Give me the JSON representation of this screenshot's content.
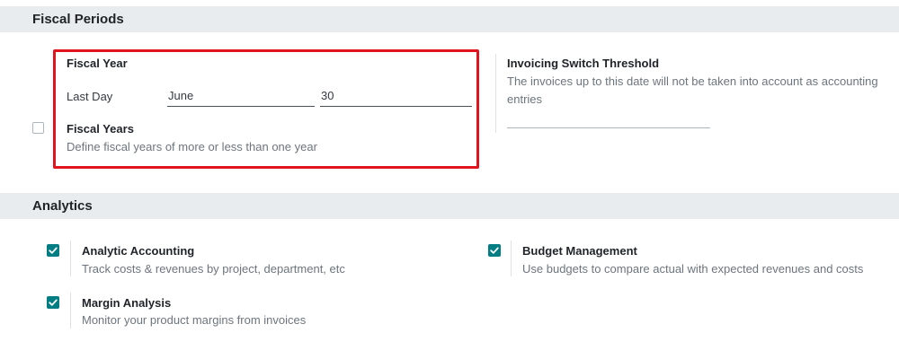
{
  "sections": {
    "fiscal_periods": {
      "title": "Fiscal Periods",
      "fiscal_year": {
        "title": "Fiscal Year",
        "last_day_label": "Last Day",
        "month_value": "June",
        "day_value": "30"
      },
      "fiscal_years": {
        "title": "Fiscal Years",
        "description": "Define fiscal years of more or less than one year",
        "checked": false
      },
      "invoicing_switch_threshold": {
        "title": "Invoicing Switch Threshold",
        "description_line1": "The invoices up to this date will not be taken into account as accounting",
        "description_line2": "entries",
        "value": ""
      }
    },
    "analytics": {
      "title": "Analytics",
      "analytic_accounting": {
        "title": "Analytic Accounting",
        "description": "Track costs & revenues by project, department, etc",
        "checked": true
      },
      "budget_management": {
        "title": "Budget Management",
        "description": "Use budgets to compare actual with expected revenues and costs",
        "checked": true
      },
      "margin_analysis": {
        "title": "Margin Analysis",
        "description": "Monitor your product margins from invoices",
        "checked": true
      }
    }
  },
  "colors": {
    "accent": "#017e84",
    "highlight": "#e0141e",
    "section_bg": "#e9ecef"
  }
}
